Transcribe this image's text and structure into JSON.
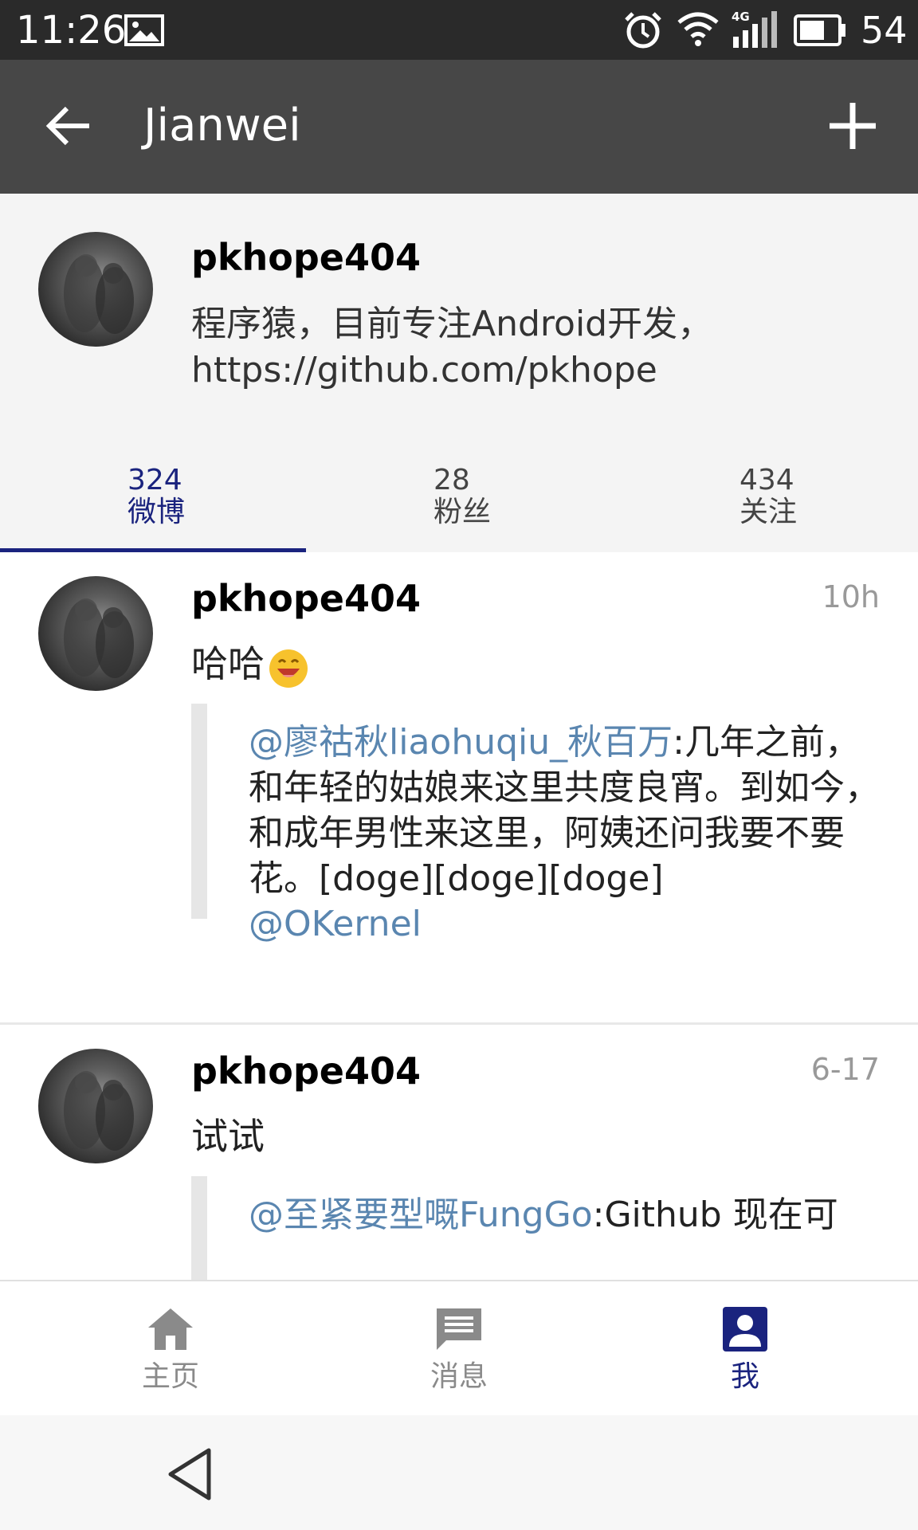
{
  "status_bar": {
    "time": "11:26",
    "battery": "54",
    "network": "4G",
    "icons": [
      "image-icon",
      "alarm-icon",
      "wifi-icon",
      "signal-icon",
      "battery-icon"
    ]
  },
  "app_bar": {
    "title": "Jianwei",
    "back_icon": "arrow-left-icon",
    "add_icon": "plus-icon"
  },
  "profile": {
    "name": "pkhope404",
    "bio": "程序猿，目前专注Android开发，https://github.com/pkhope"
  },
  "stats_tabs": [
    {
      "count": "324",
      "label": "微博"
    },
    {
      "count": "28",
      "label": "粉丝"
    },
    {
      "count": "434",
      "label": "关注"
    }
  ],
  "active_tab": "微博",
  "posts": [
    {
      "author": "pkhope404",
      "time": "10h",
      "text": "哈哈",
      "emoji": "laughing-emoji-icon",
      "repost": {
        "mention": "@廖祜秋liaohuqiu_秋百万",
        "text": ":几年之前，和年轻的姑娘来这里共度良宵。到如今，和成年男性来这里，阿姨还问我要不要花。[doge][doge][doge]",
        "mention2": "@OKernel"
      }
    },
    {
      "author": "pkhope404",
      "time": "6-17",
      "text": "试试",
      "repost": {
        "mention": "@至紧要型嘅FungGo",
        "text": ":Github 现在可"
      }
    }
  ],
  "bottom_nav": [
    {
      "label": "主页",
      "icon": "home-icon"
    },
    {
      "label": "消息",
      "icon": "message-icon"
    },
    {
      "label": "我",
      "icon": "person-icon"
    }
  ],
  "active_nav": "我",
  "colors": {
    "status_bar": "#2a2a2a",
    "app_bar": "#474747",
    "accent": "#1a237e",
    "mention": "#5a86b0",
    "header_bg": "#f4f4f4"
  }
}
